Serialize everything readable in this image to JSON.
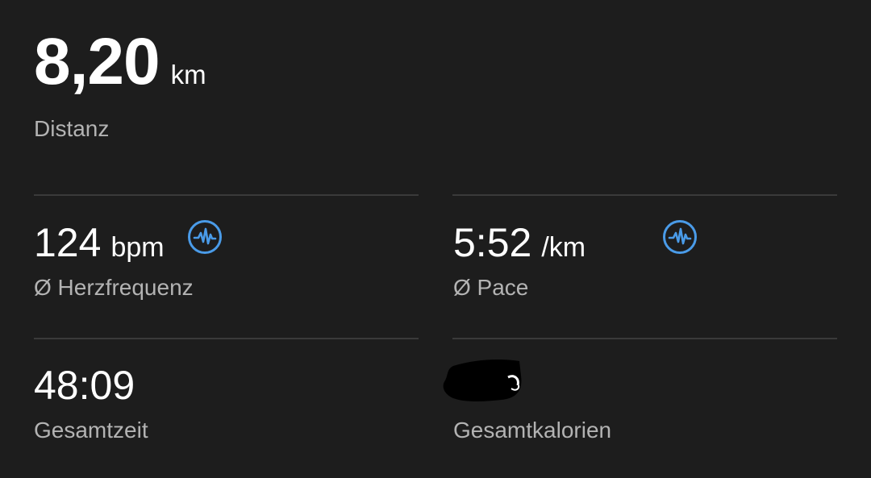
{
  "distance": {
    "value": "8,20",
    "unit": "km",
    "label": "Distanz"
  },
  "heart_rate": {
    "value": "124",
    "unit": "bpm",
    "label": "Ø Herzfrequenz",
    "icon": "heart-rate-wave-icon"
  },
  "pace": {
    "value": "5:52",
    "unit": "/km",
    "label": "Ø Pace",
    "icon": "heart-rate-wave-icon"
  },
  "total_time": {
    "value": "48:09",
    "label": "Gesamtzeit"
  },
  "calories": {
    "label": "Gesamtkalorien"
  },
  "colors": {
    "background": "#1d1d1d",
    "text": "#ffffff",
    "label": "#b3b3b3",
    "divider": "#3a3a3a",
    "accent": "#4a9be8"
  }
}
